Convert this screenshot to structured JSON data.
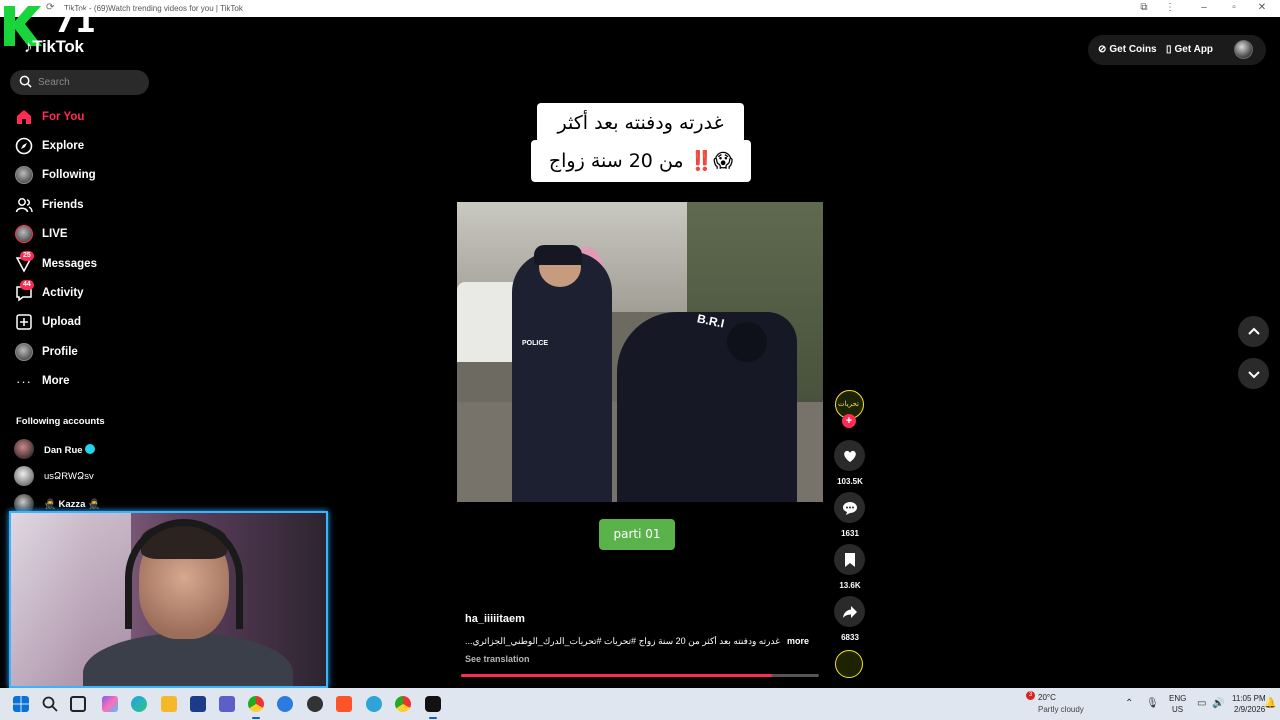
{
  "window": {
    "title": "TikTok - (69)Watch trending videos for you | TikTok",
    "back_icon": "back-icon",
    "controls": [
      "extensions-icon",
      "more-icon",
      "minimize-icon",
      "restore-icon",
      "close-icon"
    ]
  },
  "overlay": {
    "channel_number": "71"
  },
  "app": {
    "logo_text": "TikTok"
  },
  "topbar": {
    "get_coins": "Get Coins",
    "get_app": "Get App"
  },
  "search": {
    "placeholder": "Search"
  },
  "nav": {
    "items": [
      {
        "label": "For You",
        "icon": "home-icon",
        "active": true
      },
      {
        "label": "Explore",
        "icon": "compass-icon"
      },
      {
        "label": "Following",
        "icon": "avatar-icon"
      },
      {
        "label": "Friends",
        "icon": "friends-icon"
      },
      {
        "label": "LIVE",
        "icon": "live-icon"
      },
      {
        "label": "Messages",
        "icon": "messages-icon",
        "badge": "25"
      },
      {
        "label": "Activity",
        "icon": "activity-icon",
        "badge": "44"
      },
      {
        "label": "Upload",
        "icon": "upload-icon"
      },
      {
        "label": "Profile",
        "icon": "profile-avatar-icon"
      },
      {
        "label": "More",
        "icon": "more-dots-icon"
      }
    ]
  },
  "following_accounts": {
    "title": "Following accounts",
    "accounts": [
      {
        "name": "Dan Rue",
        "verified": true
      },
      {
        "name": "usՁRWՁsv"
      },
      {
        "name": "🥷 Kazza 🥷"
      }
    ]
  },
  "video": {
    "caption_line1": "غدرته ودفنته بعد أكثر",
    "caption_line2": "من 20 سنة زواج ‼️😱",
    "overlay_police": "POLICE",
    "overlay_bri": "B.R.I",
    "part_label": "parti 01",
    "author": "ha_iiiiitaem",
    "description": "غدرته ودفنته بعد أكثر من 20 سنة زواج #تحريات #تحريات_الدرك_الوطني_الجزائري...",
    "more": "more",
    "see_translation": "See translation",
    "progress": 0.87
  },
  "actions": {
    "likes": "103.5K",
    "comments": "1631",
    "saves": "13.6K",
    "shares": "6833"
  },
  "taskbar": {
    "weather_temp": "20°C",
    "weather_desc": "Partly cloudy",
    "weather_badge": "3",
    "lang_line1": "ENG",
    "lang_line2": "US",
    "time": "11:05 PM",
    "date": "2/9/2026"
  },
  "colors": {
    "accent": "#fe2c55",
    "part_button": "#59b34a",
    "webcam_border": "#3ab4ff"
  }
}
